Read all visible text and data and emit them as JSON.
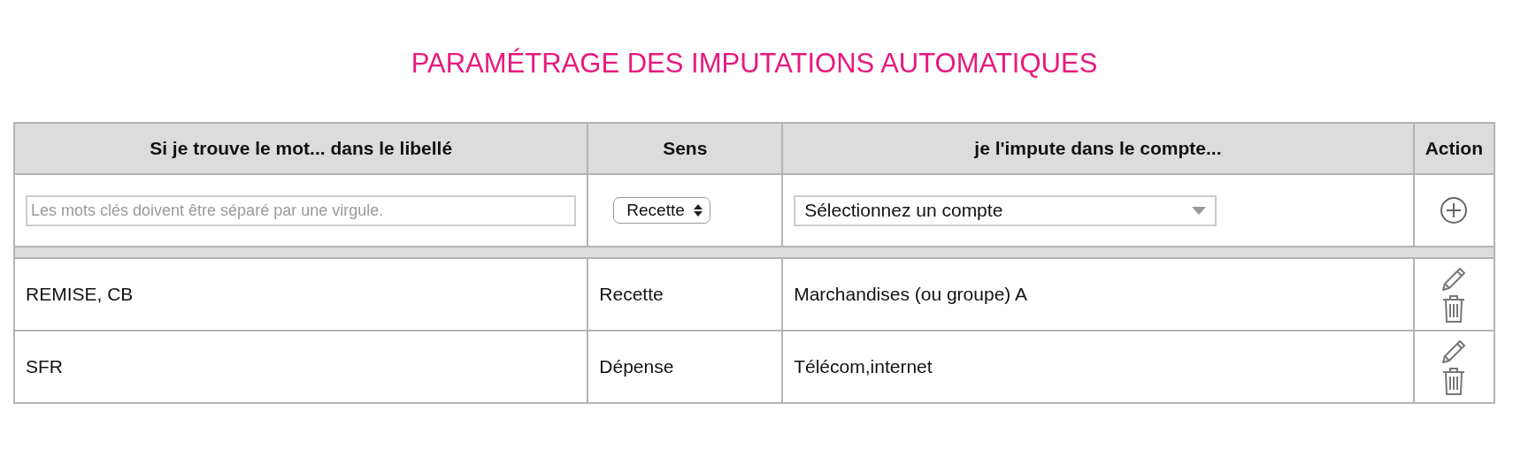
{
  "title": "PARAMÉTRAGE DES IMPUTATIONS AUTOMATIQUES",
  "table": {
    "columns": [
      "Si je trouve le mot... dans le libellé",
      "Sens",
      "je l'impute dans le compte...",
      "Action"
    ],
    "new_rule": {
      "keywords_placeholder": "Les mots clés doivent être séparé par une virgule.",
      "direction": "Recette",
      "account": "Sélectionnez un compte"
    },
    "rows": [
      {
        "keywords": "REMISE, CB",
        "direction": "Recette",
        "account": "Marchandises (ou groupe) A"
      },
      {
        "keywords": "SFR",
        "direction": "Dépense",
        "account": "Télécom,internet"
      }
    ]
  }
}
